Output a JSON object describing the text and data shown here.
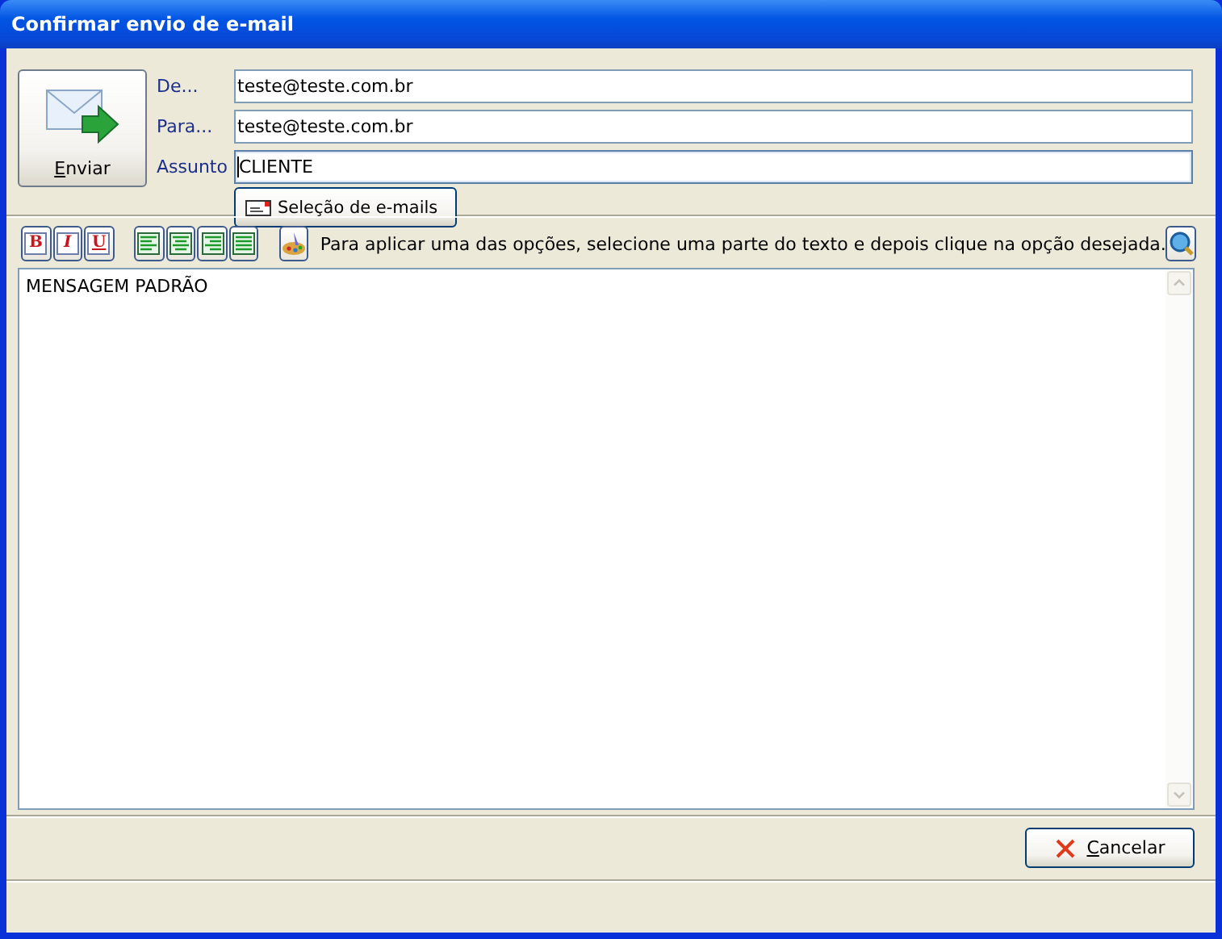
{
  "window": {
    "title": "Confirmar envio de e-mail"
  },
  "send_button": {
    "label": "Enviar"
  },
  "fields": [
    {
      "label": "De...",
      "value": "teste@teste.com.br",
      "focused": false
    },
    {
      "label": "Para...",
      "value": "teste@teste.com.br",
      "focused": false
    },
    {
      "label": "Assunto",
      "value": "CLIENTE",
      "focused": true
    }
  ],
  "select_button": {
    "label": "Seleção de e-mails"
  },
  "format_buttons": [
    {
      "kind": "bold",
      "label": "B"
    },
    {
      "kind": "italic",
      "label": "I"
    },
    {
      "kind": "underline",
      "label": "U"
    }
  ],
  "align_buttons": [
    {
      "kind": "left"
    },
    {
      "kind": "center"
    },
    {
      "kind": "right"
    },
    {
      "kind": "justify"
    }
  ],
  "hint": "Para aplicar uma das opções, selecione uma parte do texto e depois clique na opção desejada.",
  "message": "MENSAGEM PADRÃO",
  "cancel_button": {
    "label": "Cancelar"
  }
}
